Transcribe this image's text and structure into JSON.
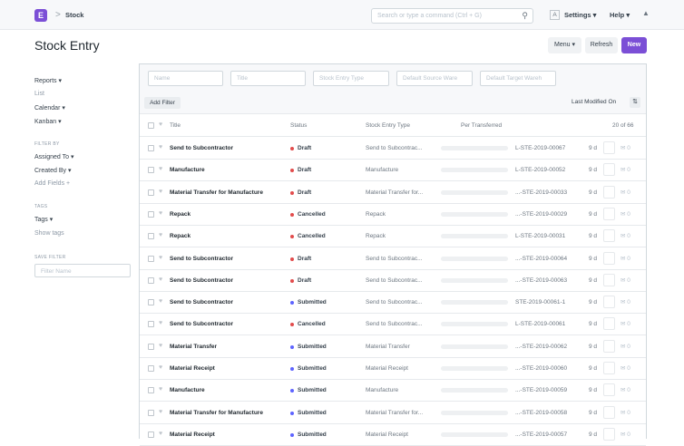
{
  "topbar": {
    "logo_letter": "E",
    "breadcrumb_sep": ">",
    "breadcrumb": "Stock",
    "search_placeholder": "Search or type a command (Ctrl + G)",
    "avatar_letter": "A",
    "settings_label": "Settings ▾",
    "help_label": "Help ▾",
    "bell_icon": "bell-icon"
  },
  "page": {
    "title": "Stock Entry",
    "menu_label": "Menu ▾",
    "refresh_label": "Refresh",
    "new_label": "New",
    "accent_color": "#7b4fd6"
  },
  "sidebar": {
    "reports": "Reports ▾",
    "list": "List",
    "calendar": "Calendar ▾",
    "kanban": "Kanban ▾",
    "filter_by_head": "FILTER BY",
    "assigned_to": "Assigned To ▾",
    "created_by": "Created By ▾",
    "add_fields": "Add Fields +",
    "tags_head": "TAGS",
    "tags": "Tags ▾",
    "show_tags": "Show tags",
    "save_filter_head": "SAVE FILTER",
    "filter_name_placeholder": "Filter Name"
  },
  "filters": {
    "name_placeholder": "Name",
    "title_placeholder": "Title",
    "type_placeholder": "Stock Entry Type",
    "source_placeholder": "Default Source Ware",
    "target_placeholder": "Default Target Wareh",
    "add_filter_label": "Add Filter",
    "sort_label": "Last Modified On",
    "sort_icon": "sort-icon"
  },
  "columns": {
    "title": "Title",
    "status": "Status",
    "type": "Stock Entry Type",
    "per_transferred": "Per Transferred",
    "count": "20 of 66"
  },
  "status_colors": {
    "Draft": "#e24c4c",
    "Cancelled": "#e24c4c",
    "Submitted": "#5e64ff"
  },
  "rows": [
    {
      "title": "Send to Subcontractor",
      "status": "Draft",
      "type": "Send to Subcontrac...",
      "name": "L-STE-2019-00067",
      "age": "9 d",
      "comments": "0"
    },
    {
      "title": "Manufacture",
      "status": "Draft",
      "type": "Manufacture",
      "name": "L-STE-2019-00052",
      "age": "9 d",
      "comments": "0"
    },
    {
      "title": "Material Transfer for Manufacture",
      "status": "Draft",
      "type": "Material Transfer for...",
      "name": "...-STE-2019-00033",
      "age": "9 d",
      "comments": "0"
    },
    {
      "title": "Repack",
      "status": "Cancelled",
      "type": "Repack",
      "name": "...-STE-2019-00029",
      "age": "9 d",
      "comments": "0"
    },
    {
      "title": "Repack",
      "status": "Cancelled",
      "type": "Repack",
      "name": "L-STE-2019-00031",
      "age": "9 d",
      "comments": "0"
    },
    {
      "title": "Send to Subcontractor",
      "status": "Draft",
      "type": "Send to Subcontrac...",
      "name": "...-STE-2019-00064",
      "age": "9 d",
      "comments": "0"
    },
    {
      "title": "Send to Subcontractor",
      "status": "Draft",
      "type": "Send to Subcontrac...",
      "name": "...-STE-2019-00063",
      "age": "9 d",
      "comments": "0"
    },
    {
      "title": "Send to Subcontractor",
      "status": "Submitted",
      "type": "Send to Subcontrac...",
      "name": "STE-2019-00061-1",
      "age": "9 d",
      "comments": "0"
    },
    {
      "title": "Send to Subcontractor",
      "status": "Cancelled",
      "type": "Send to Subcontrac...",
      "name": "L-STE-2019-00061",
      "age": "9 d",
      "comments": "0"
    },
    {
      "title": "Material Transfer",
      "status": "Submitted",
      "type": "Material Transfer",
      "name": "...-STE-2019-00062",
      "age": "9 d",
      "comments": "0"
    },
    {
      "title": "Material Receipt",
      "status": "Submitted",
      "type": "Material Receipt",
      "name": "...-STE-2019-00060",
      "age": "9 d",
      "comments": "0"
    },
    {
      "title": "Manufacture",
      "status": "Submitted",
      "type": "Manufacture",
      "name": "...-STE-2019-00059",
      "age": "9 d",
      "comments": "0"
    },
    {
      "title": "Material Transfer for Manufacture",
      "status": "Submitted",
      "type": "Material Transfer for...",
      "name": "...-STE-2019-00058",
      "age": "9 d",
      "comments": "0"
    },
    {
      "title": "Material Receipt",
      "status": "Submitted",
      "type": "Material Receipt",
      "name": "...-STE-2019-00057",
      "age": "9 d",
      "comments": "0"
    }
  ]
}
